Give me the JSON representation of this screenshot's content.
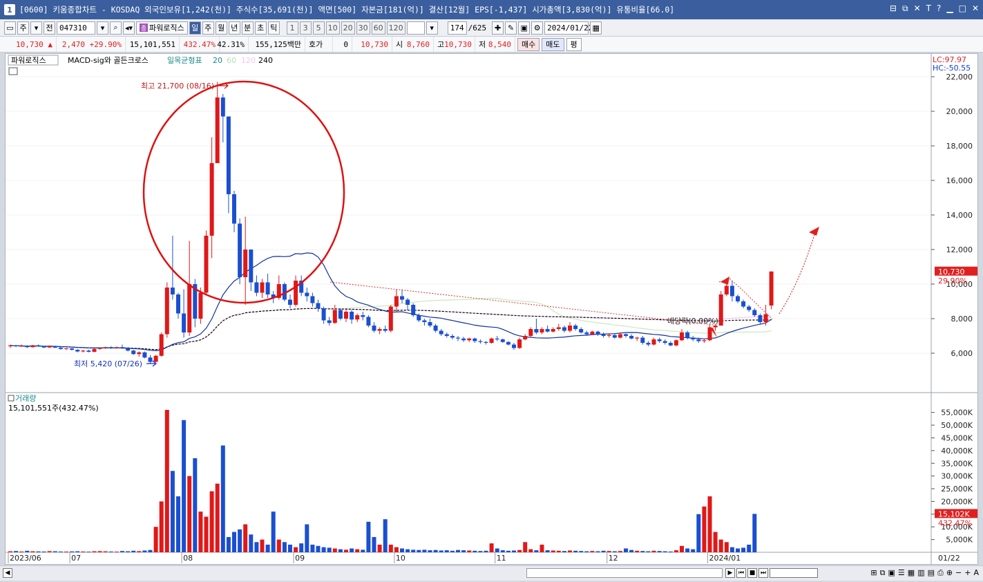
{
  "window": {
    "num": "1",
    "title": "[0600] 키움종합차트 - KOSDAQ 외국인보유[1,242(천)] 주식수[35,691(천)] 액면[500] 자본금[181(억)] 결산[12월] EPS[-1,437] 시가총액[3,830(억)] 유통비율[66.0]",
    "controls": [
      "⊟",
      "⧉",
      "✕",
      "T",
      "?",
      "▁",
      "□",
      "✕"
    ]
  },
  "toolbar": {
    "type_label": "주",
    "prev_label": "전",
    "code": "047310",
    "indicator_label": "파워로직스",
    "periods": [
      "일",
      "주",
      "월",
      "년",
      "분",
      "초",
      "틱"
    ],
    "active_period": "일",
    "minutes": [
      "1",
      "3",
      "5",
      "10",
      "20",
      "30",
      "60",
      "120"
    ],
    "count": "174",
    "total": "/625",
    "date": "2024/01/22"
  },
  "quote": {
    "price": "10,730",
    "change": "2,470",
    "change_pct": "+29.90%",
    "volume": "15,101,551",
    "volume_pct": "432.47%",
    "turnover": "42.31%",
    "amount": "155,125백만",
    "hoga_label": "호가",
    "hoga_value": "0",
    "hoga_price": "10,730",
    "open_label": "시",
    "open": "8,760",
    "high_label": "고",
    "high": "10,730",
    "low_label": "저",
    "low": "8,540",
    "buy_label": "매수",
    "sell_label": "매도",
    "eq_label": "평"
  },
  "legend": {
    "name": "파워로직스",
    "macd": "MACD-sig와 골든크로스",
    "ichimoku": "일목균형표",
    "periods": [
      "20",
      "60",
      "120",
      "240"
    ],
    "lc": "LC:97.97",
    "hc": "HC:-50.55"
  },
  "annotations": {
    "high": "최고 21,700 (08/16)",
    "low": "최저 5,420 (07/26)",
    "dividend": "배당락(0.00%)"
  },
  "price_axis": {
    "ticks": [
      "22,000",
      "20,000",
      "18,000",
      "16,000",
      "14,000",
      "12,000",
      "10,000",
      "8,000",
      "6,000"
    ],
    "last": "10,730",
    "last_pct": "29.90%"
  },
  "volume_pane": {
    "title": "거래량",
    "value": "15,101,551주(432.47%)",
    "ticks": [
      "55,000K",
      "50,000K",
      "45,000K",
      "40,000K",
      "35,000K",
      "30,000K",
      "25,000K",
      "20,000K",
      "15,000K",
      "10,000K",
      "5,000K"
    ],
    "last": "15,102K",
    "last_pct": "432.47%"
  },
  "date_axis": {
    "labels": [
      "2023/06",
      "07",
      "08",
      "09",
      "10",
      "11",
      "12",
      "2024/01"
    ],
    "right": "01/22"
  },
  "chart_data": {
    "type": "candlestick",
    "last_close": 10730,
    "high": 21700,
    "low": 5420,
    "candles": [
      [
        6400,
        6500,
        6300,
        6450
      ],
      [
        6450,
        6480,
        6350,
        6400
      ],
      [
        6400,
        6500,
        6380,
        6420
      ],
      [
        6420,
        6460,
        6300,
        6350
      ],
      [
        6350,
        6480,
        6330,
        6460
      ],
      [
        6460,
        6500,
        6380,
        6400
      ],
      [
        6400,
        6420,
        6300,
        6330
      ],
      [
        6330,
        6450,
        6320,
        6420
      ],
      [
        6420,
        6440,
        6300,
        6320
      ],
      [
        6320,
        6350,
        6200,
        6250
      ],
      [
        6250,
        6300,
        6180,
        6280
      ],
      [
        6280,
        6300,
        6150,
        6200
      ],
      [
        6200,
        6230,
        6050,
        6100
      ],
      [
        6100,
        6200,
        6050,
        6150
      ],
      [
        6150,
        6200,
        6050,
        6080
      ],
      [
        6080,
        6300,
        6050,
        6250
      ],
      [
        6250,
        6350,
        6200,
        6300
      ],
      [
        6300,
        6380,
        6250,
        6350
      ],
      [
        6350,
        6400,
        6250,
        6300
      ],
      [
        6300,
        6380,
        6260,
        6350
      ],
      [
        6350,
        6500,
        6250,
        6300
      ],
      [
        6300,
        6350,
        6100,
        6150
      ],
      [
        6150,
        6200,
        5900,
        5950
      ],
      [
        5950,
        6100,
        5800,
        6050
      ],
      [
        6050,
        6100,
        5700,
        5750
      ],
      [
        5750,
        5900,
        5420,
        5500
      ],
      [
        5500,
        5900,
        5480,
        5850
      ],
      [
        5850,
        7200,
        5800,
        7100
      ],
      [
        7100,
        10100,
        6900,
        9800
      ],
      [
        9800,
        12800,
        9100,
        9400
      ],
      [
        9400,
        9500,
        8000,
        8300
      ],
      [
        8300,
        9700,
        6900,
        7200
      ],
      [
        7200,
        12500,
        7000,
        10000
      ],
      [
        10000,
        10300,
        7500,
        8000
      ],
      [
        8000,
        9800,
        7700,
        9500
      ],
      [
        9500,
        13100,
        9400,
        12800
      ],
      [
        12800,
        18500,
        11500,
        17000
      ],
      [
        17000,
        21700,
        17000,
        20800
      ],
      [
        20800,
        21000,
        18200,
        19700
      ],
      [
        19700,
        19700,
        14100,
        15200
      ],
      [
        15200,
        15400,
        13000,
        13500
      ],
      [
        13500,
        13800,
        10000,
        10400
      ],
      [
        10400,
        13900,
        8800,
        12000
      ],
      [
        12000,
        12000,
        9600,
        10100
      ],
      [
        10100,
        10500,
        9300,
        9500
      ],
      [
        9500,
        10300,
        9200,
        10100
      ],
      [
        10100,
        10600,
        9200,
        9400
      ],
      [
        9400,
        9600,
        8900,
        9200
      ],
      [
        9200,
        10500,
        9100,
        10000
      ],
      [
        10000,
        10100,
        9000,
        9100
      ],
      [
        9100,
        9400,
        8600,
        8800
      ],
      [
        8800,
        10500,
        8700,
        10200
      ],
      [
        10200,
        10500,
        9300,
        9500
      ],
      [
        9500,
        9800,
        9000,
        9300
      ],
      [
        9300,
        9500,
        8700,
        8900
      ],
      [
        8900,
        9100,
        8400,
        8600
      ],
      [
        8600,
        8700,
        7700,
        7900
      ],
      [
        7900,
        8100,
        7600,
        7750
      ],
      [
        7750,
        8800,
        7700,
        8500
      ],
      [
        8500,
        8600,
        7900,
        8000
      ],
      [
        8000,
        8600,
        7800,
        8400
      ],
      [
        8400,
        8500,
        7700,
        7950
      ],
      [
        7950,
        8300,
        7800,
        8200
      ],
      [
        8200,
        8400,
        7900,
        8100
      ],
      [
        8100,
        8200,
        7500,
        7600
      ],
      [
        7600,
        7800,
        7200,
        7300
      ],
      [
        7300,
        7500,
        7100,
        7400
      ],
      [
        7400,
        7600,
        7200,
        7300
      ],
      [
        7300,
        8800,
        7200,
        8700
      ],
      [
        8700,
        9700,
        8400,
        9300
      ],
      [
        9300,
        9700,
        8900,
        9100
      ],
      [
        9100,
        9200,
        8500,
        8800
      ],
      [
        8800,
        8900,
        8100,
        8200
      ],
      [
        8200,
        8300,
        7800,
        7900
      ],
      [
        7900,
        8000,
        7600,
        7800
      ],
      [
        7800,
        8000,
        7500,
        7600
      ],
      [
        7600,
        7700,
        7200,
        7300
      ],
      [
        7300,
        7400,
        7000,
        7100
      ],
      [
        7100,
        7200,
        6900,
        7000
      ],
      [
        7000,
        7100,
        6800,
        6900
      ],
      [
        6900,
        7000,
        6700,
        6850
      ],
      [
        6850,
        6950,
        6650,
        6750
      ],
      [
        6750,
        6900,
        6650,
        6850
      ],
      [
        6850,
        6900,
        6600,
        6700
      ],
      [
        6700,
        6800,
        6550,
        6650
      ],
      [
        6650,
        6700,
        6500,
        6600
      ],
      [
        6600,
        6900,
        6550,
        6850
      ],
      [
        6850,
        7000,
        6700,
        6800
      ],
      [
        6800,
        6850,
        6600,
        6650
      ],
      [
        6650,
        6700,
        6450,
        6500
      ],
      [
        6500,
        6600,
        6200,
        6300
      ],
      [
        6300,
        6900,
        6250,
        6800
      ],
      [
        6800,
        7100,
        6750,
        7000
      ],
      [
        7000,
        7500,
        6900,
        7400
      ],
      [
        7400,
        8000,
        7100,
        7200
      ],
      [
        7200,
        7500,
        7100,
        7400
      ],
      [
        7400,
        7600,
        7200,
        7250
      ],
      [
        7250,
        7500,
        7200,
        7400
      ],
      [
        7400,
        7700,
        7300,
        7500
      ],
      [
        7500,
        7600,
        7200,
        7300
      ],
      [
        7300,
        7800,
        7200,
        7600
      ],
      [
        7600,
        7700,
        7300,
        7400
      ],
      [
        7400,
        7500,
        7150,
        7200
      ],
      [
        7200,
        7300,
        7000,
        7100
      ],
      [
        7100,
        7300,
        7050,
        7250
      ],
      [
        7250,
        7300,
        7000,
        7100
      ],
      [
        7100,
        7200,
        6900,
        7000
      ],
      [
        7000,
        7100,
        6900,
        7050
      ],
      [
        7050,
        7150,
        6850,
        6900
      ],
      [
        6900,
        7200,
        6850,
        7100
      ],
      [
        7100,
        7150,
        6900,
        7000
      ],
      [
        7000,
        7100,
        6800,
        6850
      ],
      [
        6850,
        6950,
        6700,
        6900
      ],
      [
        6900,
        7000,
        6500,
        6600
      ],
      [
        6600,
        6700,
        6400,
        6500
      ],
      [
        6500,
        6900,
        6450,
        6800
      ],
      [
        6800,
        6900,
        6600,
        6700
      ],
      [
        6700,
        6800,
        6500,
        6600
      ],
      [
        6600,
        6700,
        6400,
        6450
      ],
      [
        6450,
        6800,
        6400,
        6750
      ],
      [
        6750,
        7400,
        6700,
        7200
      ],
      [
        7200,
        7300,
        6800,
        6900
      ],
      [
        6900,
        7000,
        6700,
        6800
      ],
      [
        6800,
        6900,
        6600,
        6700
      ],
      [
        6700,
        6800,
        6600,
        6750
      ],
      [
        6750,
        7700,
        6700,
        7500
      ],
      [
        7500,
        7700,
        7300,
        7600
      ],
      [
        7600,
        9600,
        7600,
        9400
      ],
      [
        9400,
        10100,
        9300,
        9900
      ],
      [
        9900,
        10200,
        9000,
        9300
      ],
      [
        9300,
        9400,
        8900,
        9000
      ],
      [
        9000,
        9100,
        8600,
        8700
      ],
      [
        8700,
        8800,
        8400,
        8500
      ],
      [
        8500,
        8600,
        8100,
        8200
      ],
      [
        8200,
        8300,
        7700,
        7800
      ],
      [
        7800,
        8800,
        7600,
        8260
      ],
      [
        8760,
        10730,
        8540,
        10730
      ]
    ],
    "volume_k": [
      400,
      500,
      300,
      600,
      400,
      350,
      300,
      450,
      400,
      300,
      280,
      350,
      400,
      300,
      250,
      400,
      450,
      380,
      300,
      260,
      500,
      400,
      600,
      450,
      700,
      900,
      10000,
      20000,
      56000,
      32000,
      22000,
      52000,
      30000,
      37000,
      16000,
      14000,
      24000,
      27000,
      42000,
      6000,
      8000,
      9000,
      11000,
      7000,
      4000,
      5000,
      3000,
      16000,
      5000,
      4000,
      3000,
      2000,
      3500,
      11000,
      3000,
      2500,
      2000,
      1800,
      1500,
      1200,
      1000,
      1500,
      1200,
      1000,
      12000,
      6000,
      3000,
      13000,
      3000,
      2000,
      1500,
      1200,
      1000,
      900,
      1000,
      800,
      900,
      700,
      800,
      600,
      900,
      800,
      700,
      600,
      500,
      600,
      3500,
      1500,
      800,
      600,
      700,
      900,
      4000,
      1200,
      800,
      3000,
      800,
      700,
      600,
      500,
      700,
      600,
      500,
      400,
      500,
      400,
      600,
      500,
      400,
      500,
      1500,
      900,
      600,
      500,
      400,
      600,
      500,
      400,
      300,
      800,
      2500,
      1500,
      1200,
      15000,
      18000,
      22000,
      8000,
      5000,
      4000,
      2000,
      1500,
      1800,
      3000,
      15102
    ]
  }
}
